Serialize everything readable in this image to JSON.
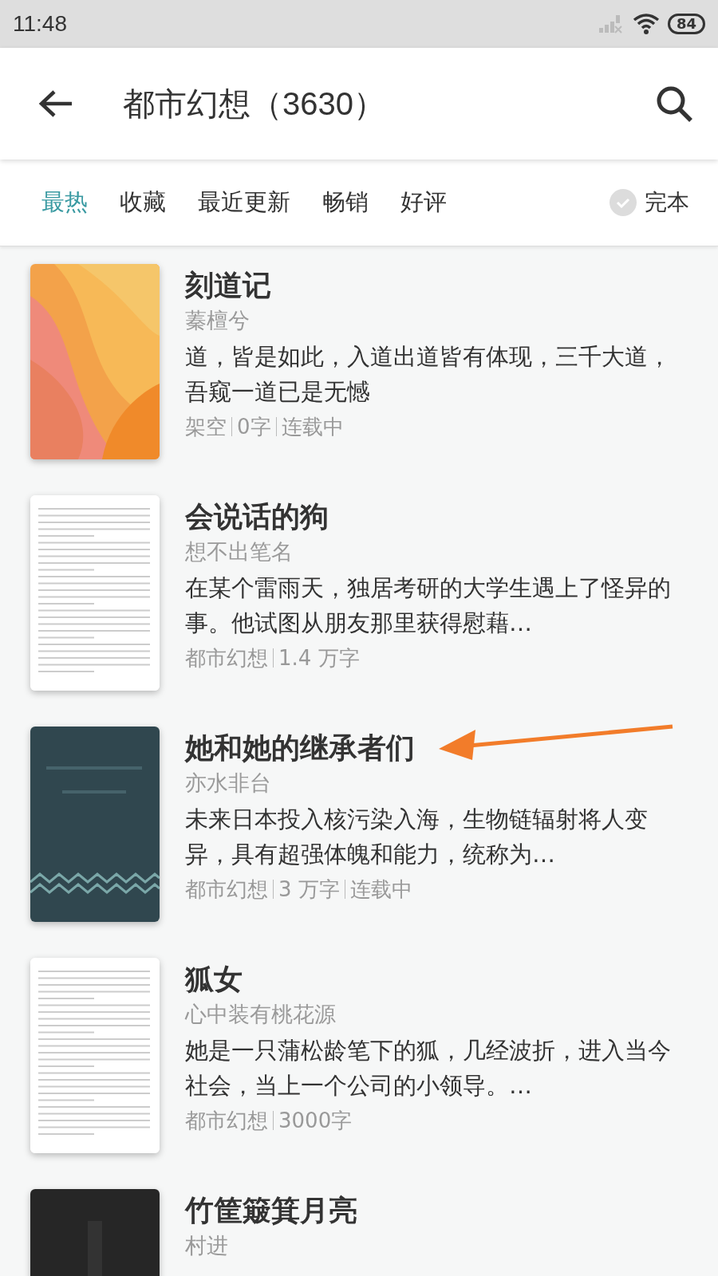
{
  "status_bar": {
    "time": "11:48",
    "battery": "84"
  },
  "header": {
    "title": "都市幻想（3630）"
  },
  "tabs": [
    {
      "label": "最热",
      "selected": true
    },
    {
      "label": "收藏",
      "selected": false
    },
    {
      "label": "最近更新",
      "selected": false
    },
    {
      "label": "畅销",
      "selected": false
    },
    {
      "label": "好评",
      "selected": false
    }
  ],
  "finished_filter": {
    "label": "完本",
    "checked": false
  },
  "books": [
    {
      "cover": {
        "kind": "warm"
      },
      "title": "刻道记",
      "author": "蓁檀兮",
      "description": "道，皆是如此，入道出道皆有体现，三千大道，吾窥一道已是无憾",
      "meta": [
        "架空",
        "0字",
        "连载中"
      ]
    },
    {
      "cover": {
        "kind": "text"
      },
      "title": "会说话的狗",
      "author": "想不出笔名",
      "description": "在某个雷雨天，独居考研的大学生遇上了怪异的事。他试图从朋友那里获得慰藉…",
      "meta": [
        "都市幻想",
        "1.4 万字"
      ]
    },
    {
      "cover": {
        "kind": "wave"
      },
      "title": "她和她的继承者们",
      "author": "亦水非台",
      "description": "未来日本投入核污染入海，生物链辐射将人变异，具有超强体魄和能力，统称为…",
      "meta": [
        "都市幻想",
        "3 万字",
        "连载中"
      ],
      "annotated": true
    },
    {
      "cover": {
        "kind": "text"
      },
      "title": "狐女",
      "author": "心中装有桃花源",
      "description": "她是一只蒲松龄笔下的狐，几经波折，进入当今社会，当上一个公司的小领导。…",
      "meta": [
        "都市幻想",
        "3000字"
      ]
    },
    {
      "cover": {
        "kind": "dark"
      },
      "title": "竹筐簸箕月亮",
      "author": "村进"
    }
  ]
}
